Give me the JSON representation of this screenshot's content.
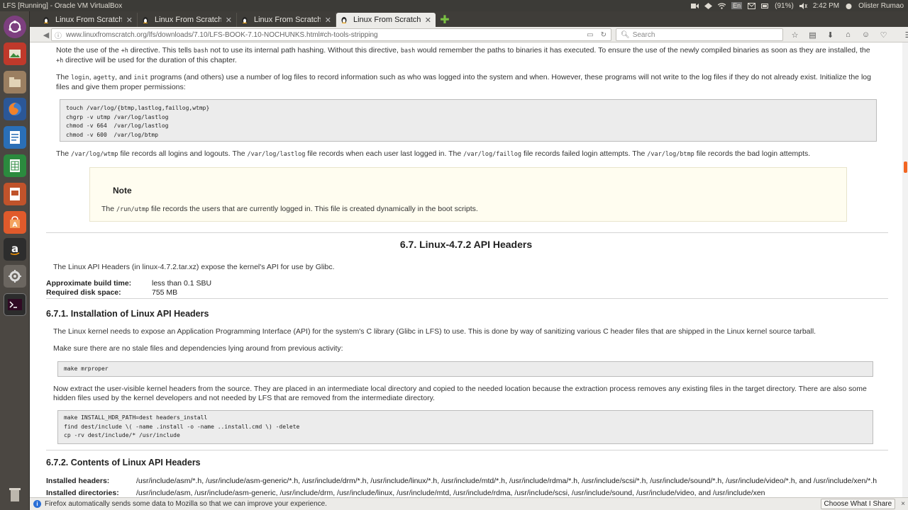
{
  "window": {
    "title": "LFS [Running] - Oracle VM VirtualBox",
    "battery": "(91%)",
    "time": "2:42 PM",
    "user": "Olister Rumao",
    "keyboard": "En"
  },
  "tabs": [
    {
      "label": "Linux From Scratch",
      "active": false
    },
    {
      "label": "Linux From Scratch",
      "active": false
    },
    {
      "label": "Linux From Scratch",
      "active": false
    },
    {
      "label": "Linux From Scratch",
      "active": true
    }
  ],
  "nav": {
    "url": "www.linuxfromscratch.org/lfs/downloads/7.10/LFS-BOOK-7.10-NOCHUNKS.html#ch-tools-stripping",
    "search_placeholder": "Search"
  },
  "content": {
    "p_hash": {
      "a": "Note the use of the ",
      "code1": "+h",
      "b": " directive. This tells ",
      "code2": "bash",
      "c": " not to use its internal path hashing. Without this directive, ",
      "code3": "bash",
      "d": " would remember the paths to binaries it has executed. To ensure the use of the newly compiled binaries as soon as they are installed, the",
      "code4": "+h",
      "e": " directive will be used for the duration of this chapter."
    },
    "p_login": {
      "a": "The ",
      "code1": "login",
      "b": ", ",
      "code2": "agetty",
      "c": ", and ",
      "code3": "init",
      "d": " programs (and others) use a number of log files to record information such as who was logged into the system and when. However, these programs will not write to the log files if they do not already exist. Initialize the log",
      "e": "files and give them proper permissions:"
    },
    "code_logs": "touch /var/log/{btmp,lastlog,faillog,wtmp}\nchgrp -v utmp /var/log/lastlog\nchmod -v 664  /var/log/lastlog\nchmod -v 600  /var/log/btmp",
    "p_wtmp": {
      "a": "The ",
      "code1": "/var/log/wtmp",
      "b": " file records all logins and logouts. The ",
      "code2": "/var/log/lastlog",
      "c": " file records when each user last logged in. The ",
      "code3": "/var/log/faillog",
      "d": " file records failed login attempts. The ",
      "code4": "/var/log/btmp",
      "e": " file records the bad login attempts."
    },
    "note": {
      "title": "Note",
      "a": "The ",
      "code": "/run/utmp",
      "b": " file records the users that are currently logged in. This file is created dynamically in the boot scripts."
    },
    "section_title": "6.7. Linux-4.7.2 API Headers",
    "section_intro": "The Linux API Headers (in linux-4.7.2.tar.xz) expose the kernel's API for use by Glibc.",
    "build_time_label": "Approximate build time:",
    "build_time_value": "less than 0.1 SBU",
    "disk_label": "Required disk space:",
    "disk_value": "755 MB",
    "install_title": "6.7.1. Installation of Linux API Headers",
    "install_p1": "The Linux kernel needs to expose an Application Programming Interface (API) for the system's C library (Glibc in LFS) to use. This is done by way of sanitizing various C header files that are shipped in the Linux kernel source tarball.",
    "install_p2": "Make sure there are no stale files and dependencies lying around from previous activity:",
    "code_mrproper": "make mrproper",
    "install_p3a": "Now extract the user-visible kernel headers from the source. They are placed in an intermediate local directory and copied to the needed location because the extraction process removes any existing files in the target directory. There are also some",
    "install_p3b": "hidden files used by the kernel developers and not needed by LFS that are removed from the intermediate directory.",
    "code_install": "make INSTALL_HDR_PATH=dest headers_install\nfind dest/include \\( -name .install -o -name ..install.cmd \\) -delete\ncp -rv dest/include/* /usr/include",
    "contents_title": "6.7.2. Contents of Linux API Headers",
    "installed_headers_label": "Installed headers:",
    "installed_headers_value": "/usr/include/asm/*.h, /usr/include/asm-generic/*.h, /usr/include/drm/*.h, /usr/include/linux/*.h, /usr/include/mtd/*.h, /usr/include/rdma/*.h, /usr/include/scsi/*.h, /usr/include/sound/*.h, /usr/include/video/*.h, and /usr/include/xen/*.h",
    "installed_dirs_label": "Installed directories:",
    "installed_dirs_value": "/usr/include/asm, /usr/include/asm-generic, /usr/include/drm, /usr/include/linux, /usr/include/mtd, /usr/include/rdma, /usr/include/scsi, /usr/include/sound, /usr/include/video, and /usr/include/xen"
  },
  "notification": {
    "message": "Firefox automatically sends some data to Mozilla so that we can improve your experience.",
    "button": "Choose What I Share",
    "close": "×"
  },
  "colors": {
    "panel": "#3c3b37",
    "launcher": "#4b4742",
    "accent_scroll": "#f26522",
    "note_bg": "#fffdf0"
  }
}
